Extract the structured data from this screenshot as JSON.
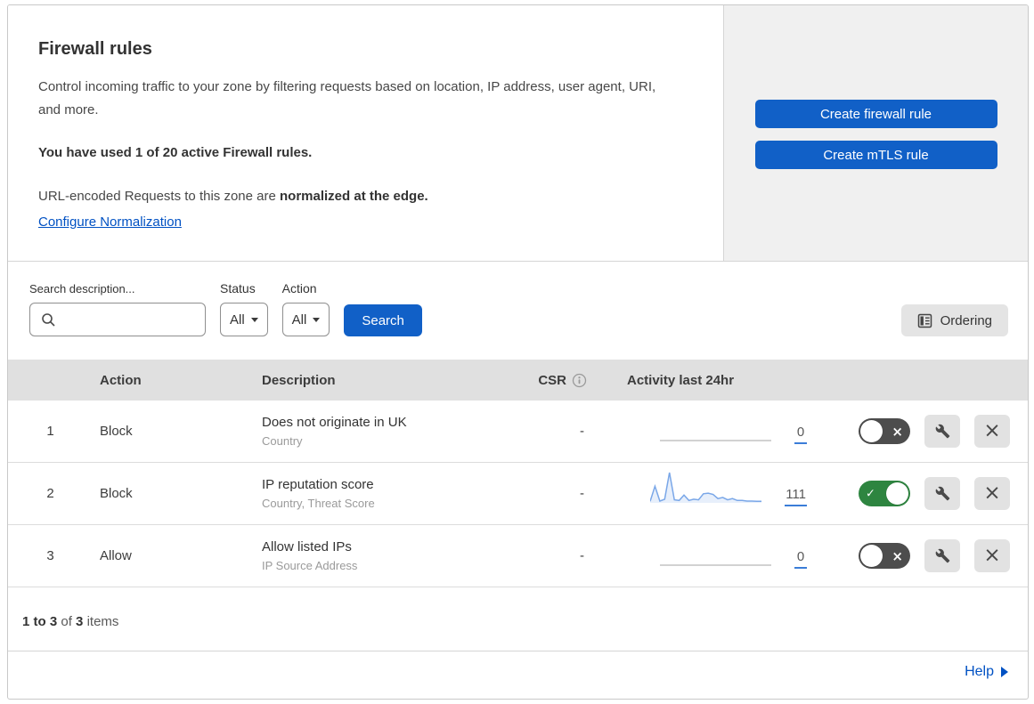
{
  "colors": {
    "accent_blue": "#1160c7",
    "link_blue": "#0051c3",
    "toggle_on_green": "#2e8540",
    "toggle_off_grey": "#4d4d4d",
    "sparkline_blue": "#7aa7e8",
    "panel_grey": "#f0f0f0",
    "table_header_grey": "#e0e0e0"
  },
  "intro": {
    "title": "Firewall rules",
    "description": "Control incoming traffic to your zone by filtering requests based on location, IP address, user agent, URI, and more.",
    "usage": "You have used 1 of 20 active Firewall rules.",
    "normalization_text": "URL-encoded Requests to this zone are",
    "normalization_bold": "normalized at the edge.",
    "normalization_link": "Configure Normalization",
    "create_firewall_button": "Create firewall rule",
    "create_mtls_button": "Create mTLS rule"
  },
  "filters": {
    "search_label": "Search description...",
    "search_value": "",
    "status_label": "Status",
    "status_value": "All",
    "action_label": "Action",
    "action_value": "All",
    "search_button": "Search",
    "ordering_button": "Ordering"
  },
  "table": {
    "columns": {
      "action": "Action",
      "description": "Description",
      "csr": "CSR",
      "activity": "Activity last 24hr"
    },
    "rows": [
      {
        "priority": "1",
        "action": "Block",
        "title": "Does not originate in UK",
        "subtitle": "Country",
        "csr": "-",
        "count": "0",
        "enabled": false,
        "sparkline": [
          0,
          0,
          0,
          0,
          0,
          0,
          0,
          0,
          0,
          0,
          0,
          0,
          0,
          0,
          0,
          0,
          0,
          0,
          0,
          0,
          0,
          0,
          0,
          0
        ]
      },
      {
        "priority": "2",
        "action": "Block",
        "title": "IP reputation score",
        "subtitle": "Country, Threat Score",
        "csr": "-",
        "count": "111",
        "enabled": true,
        "sparkline": [
          5,
          55,
          6,
          12,
          100,
          10,
          8,
          26,
          8,
          12,
          10,
          30,
          32,
          28,
          14,
          18,
          10,
          14,
          8,
          8,
          6,
          6,
          5,
          5
        ]
      },
      {
        "priority": "3",
        "action": "Allow",
        "title": "Allow listed IPs",
        "subtitle": "IP Source Address",
        "csr": "-",
        "count": "0",
        "enabled": false,
        "sparkline": [
          0,
          0,
          0,
          0,
          0,
          0,
          0,
          0,
          0,
          0,
          0,
          0,
          0,
          0,
          0,
          0,
          0,
          0,
          0,
          0,
          0,
          0,
          0,
          0
        ]
      }
    ]
  },
  "footer": {
    "range": "1 to 3",
    "of_word": "of",
    "total": "3",
    "items_word": "items",
    "help_link": "Help"
  },
  "icons": {
    "search_icon": "magnifier",
    "dropdown_caret_icon": "caret-down",
    "ordering_icon": "list-document",
    "info_icon": "info-circle",
    "wrench_icon": "wrench",
    "close_icon": "x",
    "toggle_check_icon": "check",
    "toggle_x_icon": "x",
    "help_caret_icon": "caret-right"
  }
}
